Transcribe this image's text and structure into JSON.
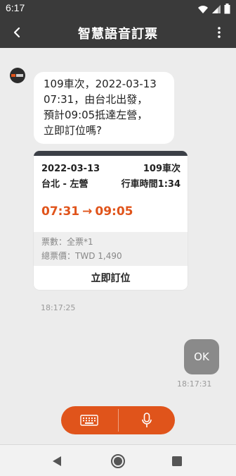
{
  "status_bar": {
    "time": "6:17"
  },
  "app_bar": {
    "title": "智慧語音訂票",
    "back_icon": "back-arrow-icon",
    "menu_icon": "more-vertical-icon"
  },
  "bot_message": {
    "lines": [
      "109車次，2022-03-13",
      "07:31，由台北出發，",
      "預計09:05抵達左營，",
      "立即訂位嗎?"
    ],
    "timestamp": "18:17:25"
  },
  "ticket": {
    "date": "2022-03-13",
    "train": "109車次",
    "route": "台北 - 左營",
    "duration": "行車時間1:34",
    "depart": "07:31",
    "arrow": "→",
    "arrive": "09:05",
    "ticket_count": "票數：全票*1",
    "total_price": "總票價：TWD 1,490",
    "action_label": "立即訂位"
  },
  "user_message": {
    "text": "OK",
    "timestamp": "18:17:31"
  },
  "input_bar": {
    "keyboard_icon": "keyboard-icon",
    "mic_icon": "microphone-icon"
  },
  "colors": {
    "accent": "#e0541b",
    "app_bar": "#3a3a3a",
    "chat_bg": "#ececec",
    "user_bubble": "#8a8a8a"
  }
}
